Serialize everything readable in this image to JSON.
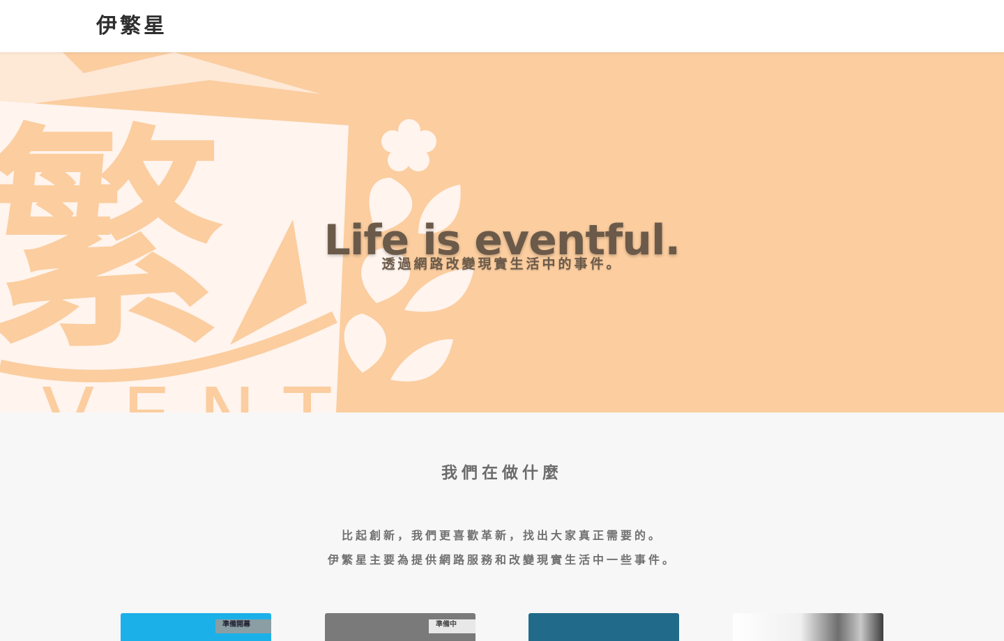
{
  "navbar": {
    "brand": "伊繁星"
  },
  "hero": {
    "title": "Life is eventful.",
    "subtitle": "透過網路改變現實生活中的事件。",
    "logo_char": "繁",
    "logo_text": "VENTS",
    "colors": {
      "background": "#fbcd9f",
      "logo_fill": "#fff4ee",
      "text": "#6b5a49"
    }
  },
  "about": {
    "title": "我們在做什麼",
    "line1": "比起創新，我們更喜歡革新，找出大家真正需要的。",
    "line2": "伊繁星主要為提供網路服務和改變現實生活中一些事件。"
  },
  "cards": [
    {
      "badge": "準備開幕",
      "color": "#1cb0e8"
    },
    {
      "badge": "準備中",
      "color": "#7a7a7a"
    },
    {
      "badge": "",
      "color": "#216a8a"
    },
    {
      "badge": "",
      "color": "#ffffff"
    }
  ]
}
